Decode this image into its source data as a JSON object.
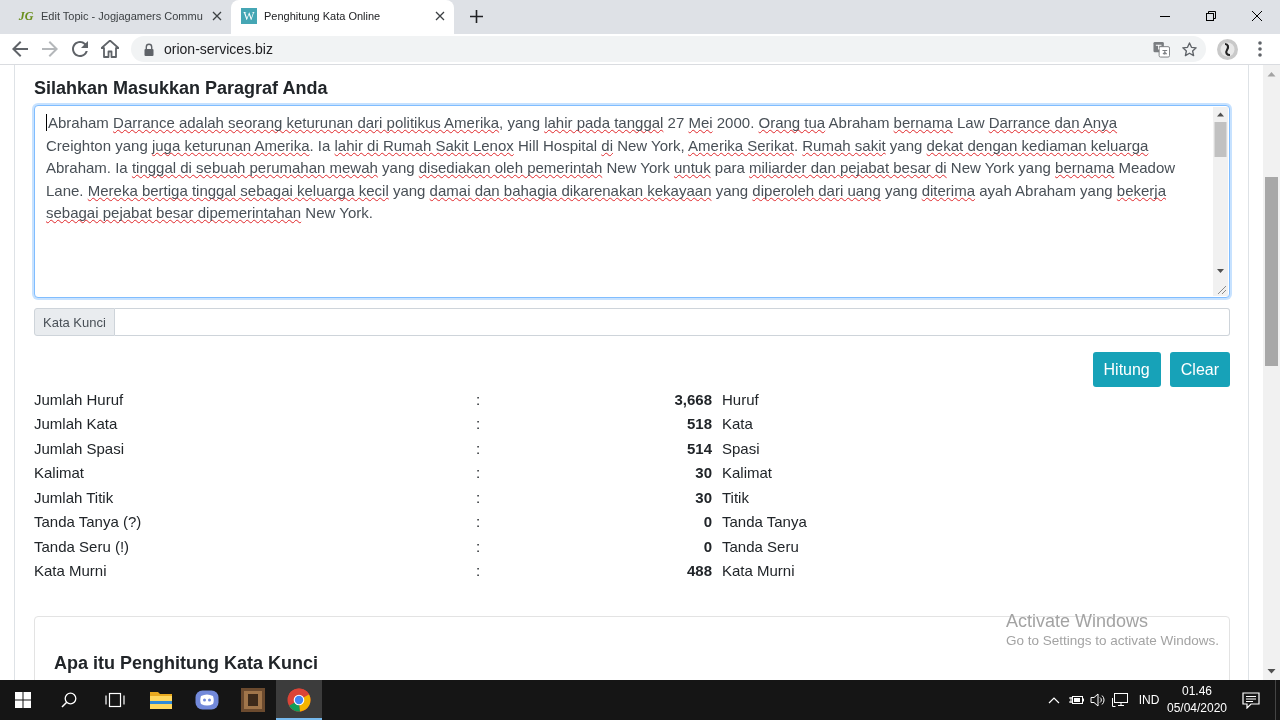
{
  "browser": {
    "tabs": [
      {
        "favicon": {
          "kind": "script",
          "text": "JG"
        },
        "title": "Edit Topic - Jogjagamers Commu",
        "selected": false
      },
      {
        "favicon": {
          "kind": "tile",
          "text": "W"
        },
        "title": "Penghitung Kata Online",
        "selected": true
      }
    ],
    "nav_buttons": [
      {
        "kind": "back",
        "disabled": false
      },
      {
        "kind": "forward",
        "disabled": true
      },
      {
        "kind": "reload",
        "disabled": false
      },
      {
        "kind": "home",
        "disabled": false
      }
    ],
    "address_bar": {
      "url": "orion-services.biz"
    }
  },
  "page": {
    "heading": "Silahkan Masukkan Paragraf Anda",
    "paragraph_field": {
      "focused": true,
      "segments": [
        {
          "text": "Abraham ",
          "misspelled": false
        },
        {
          "text": "Darrance adalah seorang keturunan dari politikus Amerika",
          "misspelled": true
        },
        {
          "text": ", yang ",
          "misspelled": false
        },
        {
          "text": "lahir pada tanggal",
          "misspelled": true
        },
        {
          "text": " 27 ",
          "misspelled": false
        },
        {
          "text": "Mei",
          "misspelled": true
        },
        {
          "text": " 2000. ",
          "misspelled": false
        },
        {
          "text": "Orang tua",
          "misspelled": true
        },
        {
          "text": " Abraham ",
          "misspelled": false
        },
        {
          "text": "bernama",
          "misspelled": true
        },
        {
          "text": " Law ",
          "misspelled": false
        },
        {
          "text": "Darrance dan Anya ",
          "misspelled": true
        },
        {
          "text": "Creighton yang ",
          "misspelled": false
        },
        {
          "text": "juga keturunan Amerika",
          "misspelled": true
        },
        {
          "text": ". Ia ",
          "misspelled": false
        },
        {
          "text": "lahir di Rumah Sakit Lenox",
          "misspelled": true
        },
        {
          "text": " Hill Hospital ",
          "misspelled": false
        },
        {
          "text": "di",
          "misspelled": true
        },
        {
          "text": " New York, ",
          "misspelled": false
        },
        {
          "text": "Amerika Serikat",
          "misspelled": true
        },
        {
          "text": ". ",
          "misspelled": false
        },
        {
          "text": "Rumah sakit",
          "misspelled": true
        },
        {
          "text": " yang ",
          "misspelled": false
        },
        {
          "text": "dekat dengan kediaman keluarga ",
          "misspelled": true
        },
        {
          "text": "Abraham. Ia ",
          "misspelled": false
        },
        {
          "text": "tinggal di sebuah perumahan mewah",
          "misspelled": true
        },
        {
          "text": " yang ",
          "misspelled": false
        },
        {
          "text": "disediakan oleh pemerintah",
          "misspelled": true
        },
        {
          "text": " New York ",
          "misspelled": false
        },
        {
          "text": "untuk",
          "misspelled": true
        },
        {
          "text": " para ",
          "misspelled": false
        },
        {
          "text": "miliarder dan pejabat besar di",
          "misspelled": true
        },
        {
          "text": " New York yang ",
          "misspelled": false
        },
        {
          "text": "bernama",
          "misspelled": true
        },
        {
          "text": " Meadow ",
          "misspelled": false
        },
        {
          "text": "Lane. ",
          "misspelled": false
        },
        {
          "text": "Mereka bertiga tinggal sebagai keluarga kecil",
          "misspelled": true
        },
        {
          "text": " yang ",
          "misspelled": false
        },
        {
          "text": "damai dan bahagia dikarenakan kekayaan",
          "misspelled": true
        },
        {
          "text": " yang ",
          "misspelled": false
        },
        {
          "text": "diperoleh dari uang",
          "misspelled": true
        },
        {
          "text": " yang ",
          "misspelled": false
        },
        {
          "text": "diterima",
          "misspelled": true
        },
        {
          "text": " ayah Abraham yang ",
          "misspelled": false
        },
        {
          "text": "bekerja ",
          "misspelled": true
        },
        {
          "text": "sebagai pejabat besar dipemerintahan",
          "misspelled": true
        },
        {
          "text": " New York.",
          "misspelled": false
        }
      ]
    },
    "keyword_field": {
      "label": "Kata Kunci"
    },
    "buttons": [
      "Hitung",
      "Clear"
    ],
    "stats": [
      {
        "label": "Jumlah Huruf",
        "separator": ":",
        "value": "3,668",
        "unit": "Huruf"
      },
      {
        "label": "Jumlah Kata",
        "separator": ":",
        "value": "518",
        "unit": "Kata"
      },
      {
        "label": "Jumlah Spasi",
        "separator": ":",
        "value": "514",
        "unit": "Spasi"
      },
      {
        "label": "Kalimat",
        "separator": ":",
        "value": "30",
        "unit": "Kalimat"
      },
      {
        "label": "Jumlah Titik",
        "separator": ":",
        "value": "30",
        "unit": "Titik"
      },
      {
        "label": "Tanda Tanya (?)",
        "separator": ":",
        "value": "0",
        "unit": "Tanda Tanya"
      },
      {
        "label": "Tanda Seru (!)",
        "separator": ":",
        "value": "0",
        "unit": "Tanda Seru"
      },
      {
        "label": "Kata Murni",
        "separator": ":",
        "value": "488",
        "unit": "Kata Murni"
      }
    ],
    "info_card": {
      "title": "Apa itu Penghitung Kata Kunci"
    }
  },
  "activation_notice": {
    "title": "Activate Windows",
    "message": "Go to Settings to activate Windows."
  },
  "taskbar": {
    "apps": [
      {
        "kind": "folder",
        "selected": false
      },
      {
        "kind": "chat",
        "selected": false
      },
      {
        "kind": "picture",
        "selected": false
      },
      {
        "kind": "browser",
        "selected": true
      }
    ],
    "language": "IND",
    "time": "01.46",
    "date": "05/04/2020"
  }
}
